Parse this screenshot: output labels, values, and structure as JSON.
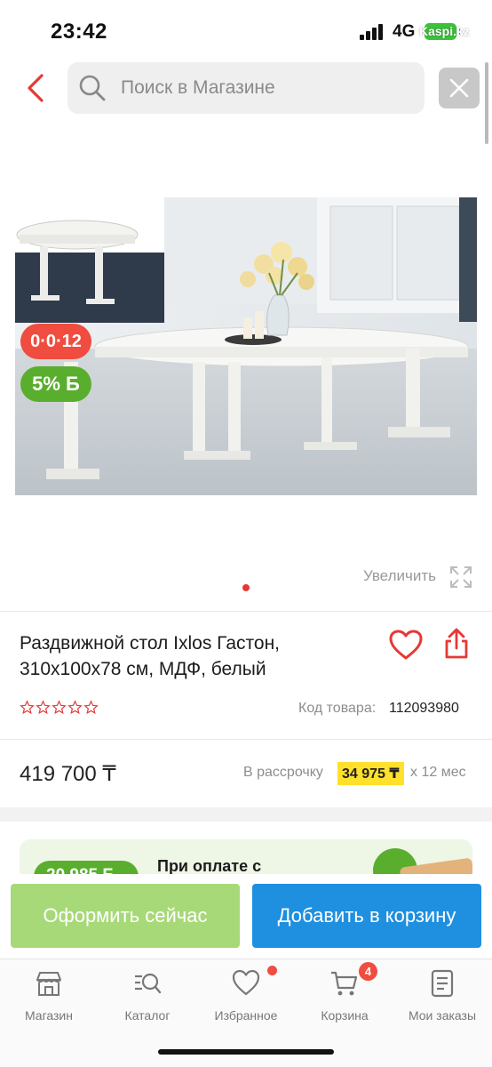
{
  "status_bar": {
    "time": "23:42",
    "network": "4G",
    "carrier_watermark": "Kaspi.kz"
  },
  "search": {
    "placeholder": "Поиск в Магазине"
  },
  "product": {
    "badges": {
      "installment": "0·0·12",
      "bonus": "5% Б"
    },
    "zoom_label": "Увеличить",
    "title_line_1": "Раздвижной стол Ixlos Гастон,",
    "title_line_2": "310x100x78 см, МДФ, белый",
    "rating_stars": 0,
    "code_label": "Код товара:",
    "code_value": "112093980",
    "price": "419 700 ₸",
    "installment_label": "В рассрочку",
    "installment_amount": "34 975 ₸",
    "installment_term": "x 12 мес"
  },
  "promo": {
    "pill_text": "20 985 Б",
    "text": "При оплате с"
  },
  "actions": {
    "checkout": "Оформить сейчас",
    "add_to_cart": "Добавить в корзину"
  },
  "tabbar": {
    "items": [
      {
        "label": "Магазин",
        "icon": "store-icon"
      },
      {
        "label": "Каталог",
        "icon": "catalog-search-icon"
      },
      {
        "label": "Избранное",
        "icon": "heart-icon"
      },
      {
        "label": "Корзина",
        "icon": "cart-icon"
      },
      {
        "label": "Мои заказы",
        "icon": "orders-icon"
      }
    ],
    "cart_count": "4"
  },
  "colors": {
    "accent_red": "#f04c3f",
    "bonus_green": "#5aae2d",
    "checkout_green": "#a7d978",
    "cart_blue": "#1f8fe0",
    "installment_yellow": "#ffe02b"
  }
}
